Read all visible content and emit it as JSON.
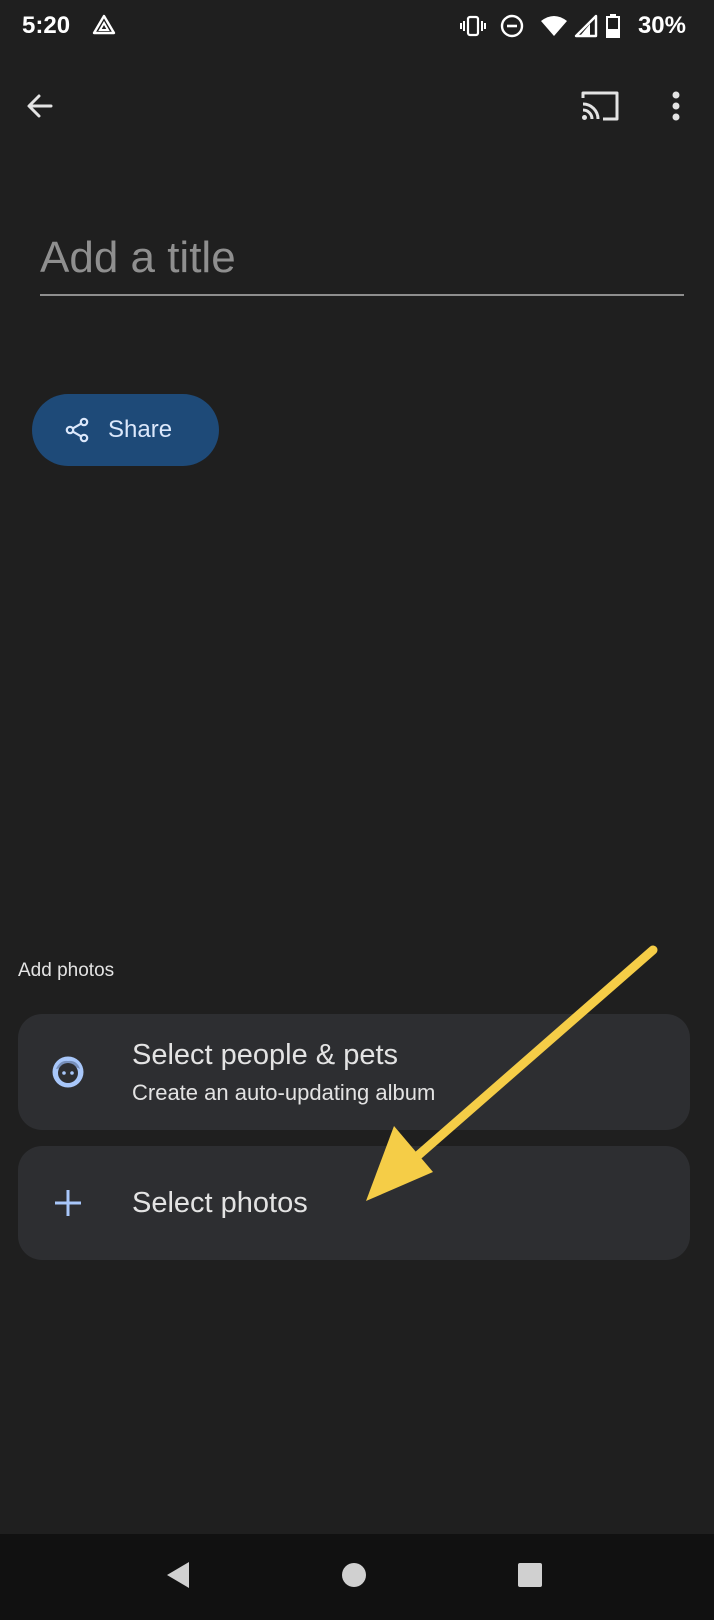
{
  "status_bar": {
    "time": "5:20",
    "battery_percent": "30%",
    "icons": [
      "drive-icon",
      "vibrate-icon",
      "dnd-icon",
      "wifi-icon",
      "signal-icon",
      "battery-icon"
    ]
  },
  "app_bar": {
    "icons": [
      "back-arrow-icon",
      "cast-icon",
      "more-vert-icon"
    ]
  },
  "title_field": {
    "placeholder": "Add a title",
    "value": ""
  },
  "share_button": {
    "label": "Share",
    "icon": "share-icon",
    "color": "#1e4a78"
  },
  "add_photos": {
    "section_label": "Add photos",
    "options": [
      {
        "title": "Select people & pets",
        "subtitle": "Create an auto-updating album",
        "icon": "face-icon"
      },
      {
        "title": "Select photos",
        "icon": "plus-icon"
      }
    ]
  },
  "annotation": {
    "arrow_color": "#f5cd47"
  },
  "nav_bar": {
    "icons": [
      "nav-back-icon",
      "nav-home-icon",
      "nav-recents-icon"
    ]
  }
}
